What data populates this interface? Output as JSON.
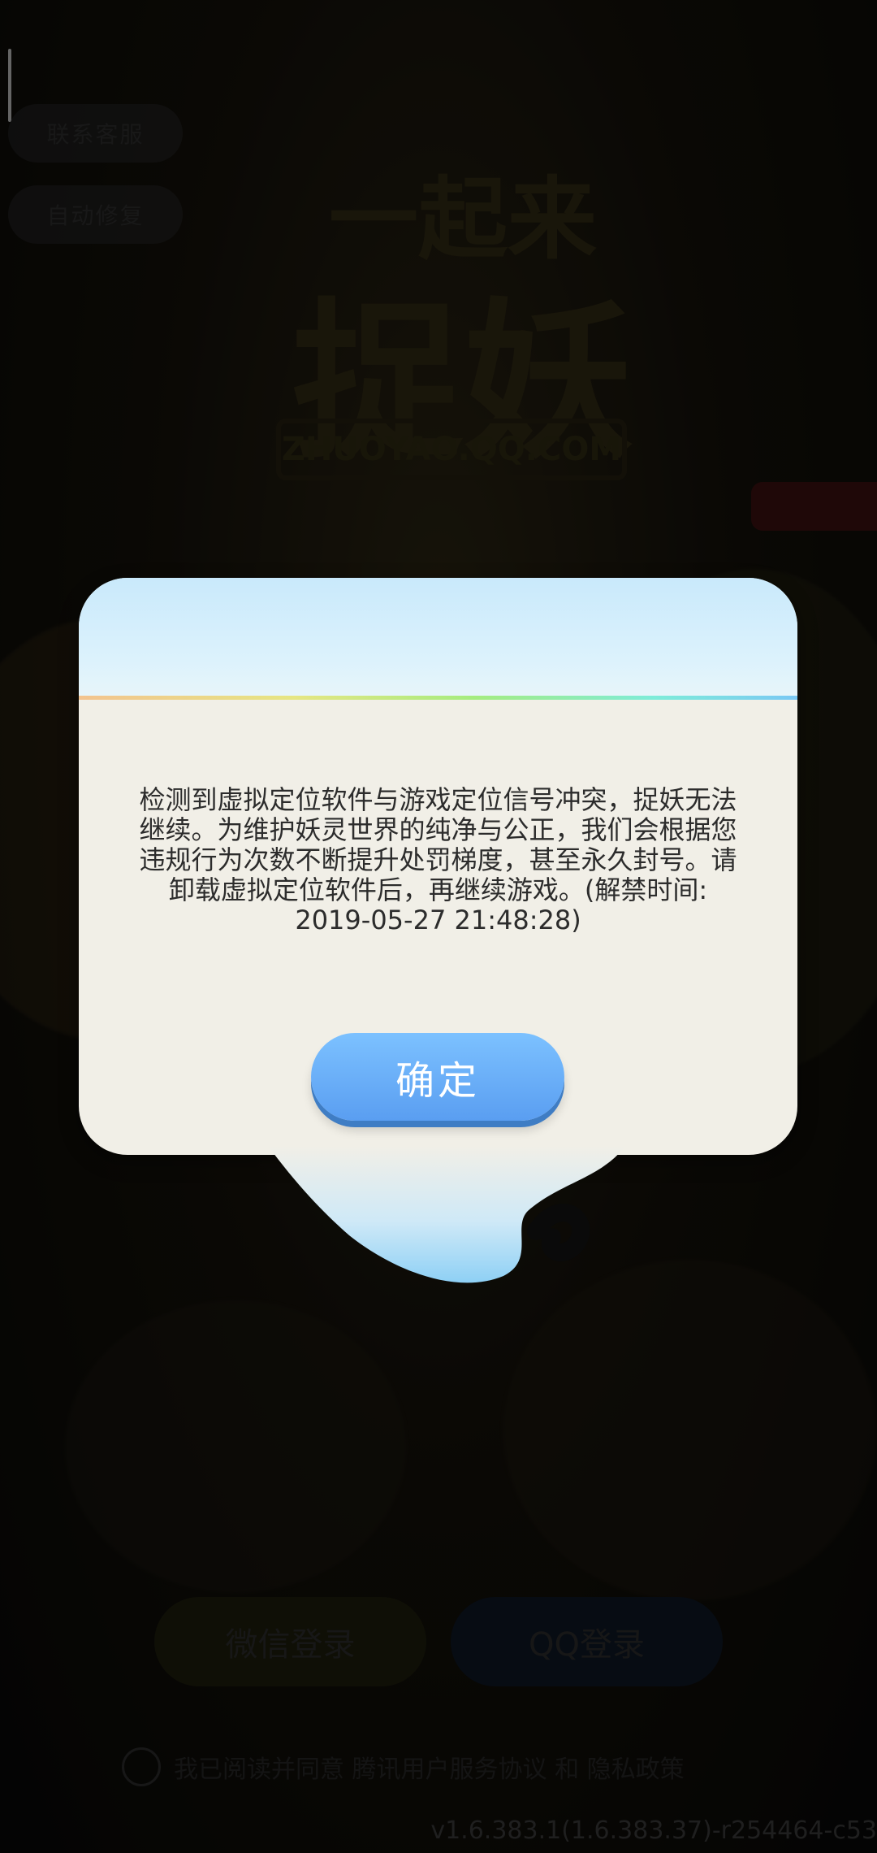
{
  "background": {
    "side_buttons": [
      "联系客服",
      "自动修复"
    ],
    "logo": {
      "line1": "一起来",
      "line2": "捉妖",
      "url": "ZHUOYAO.QQ.COM"
    },
    "login": {
      "wechat_label": "微信登录",
      "qq_label": "QQ登录"
    },
    "agreement": {
      "text": "我已阅读并同意 腾讯用户服务协议 和 隐私政策"
    },
    "version": "v1.6.383.1(1.6.383.37)-r254464-c53"
  },
  "dialog": {
    "message_lines": [
      "检测到虚拟定位软件与游戏定位信号冲突，捉妖无法",
      "继续。为维护妖灵世界的纯净与公正，我们会根据您",
      "违规行为次数不断提升处罚梯度，甚至永久封号。请",
      "卸载虚拟定位软件后，再继续游戏。(解禁时间:",
      "2019-05-27 21:48:28)"
    ],
    "confirm_label": "确定"
  },
  "colors": {
    "dialog_bg": "#f1efe7",
    "header_blue": "#c9e9fb",
    "button_blue": "#5a9ef1"
  }
}
